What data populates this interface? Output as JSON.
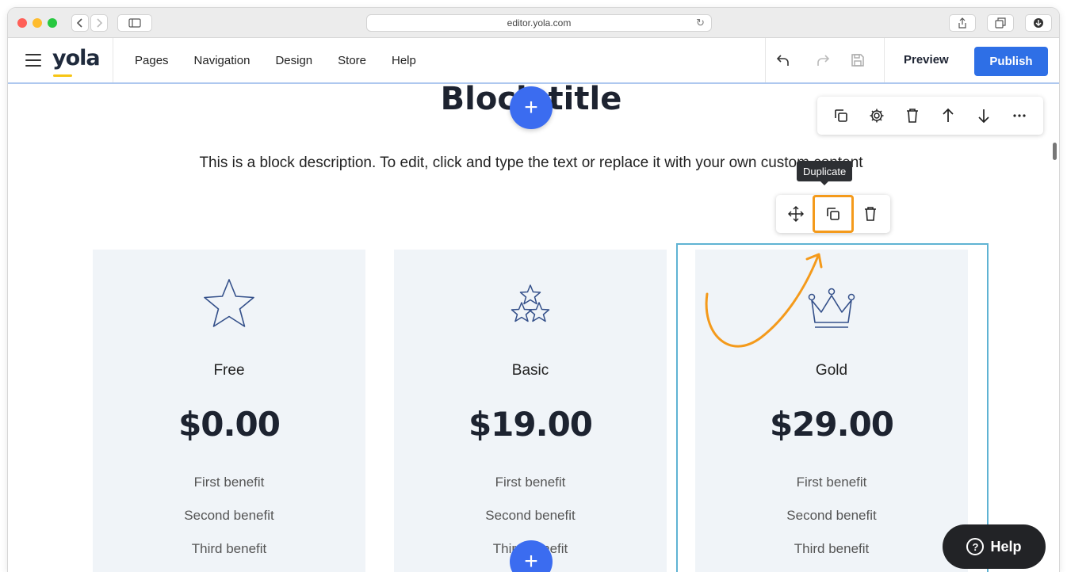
{
  "browser": {
    "url": "editor.yola.com"
  },
  "app": {
    "logo": "yola",
    "nav": [
      "Pages",
      "Navigation",
      "Design",
      "Store",
      "Help"
    ],
    "preview_label": "Preview",
    "publish_label": "Publish"
  },
  "block": {
    "title": "Block title",
    "description": "This is a block description. To edit, click and type the text or replace it with your own custom content",
    "add_label": "+",
    "toolbar_icons": [
      "duplicate-icon",
      "gear-icon",
      "trash-icon",
      "arrow-up-icon",
      "arrow-down-icon",
      "more-icon"
    ]
  },
  "tooltip": {
    "text": "Duplicate"
  },
  "item_toolbar": {
    "icons": [
      "move-icon",
      "duplicate-icon",
      "trash-icon"
    ]
  },
  "cards": [
    {
      "name": "Free",
      "price": "$0.00",
      "icon": "star-icon",
      "benefits": [
        "First benefit",
        "Second benefit",
        "Third benefit"
      ]
    },
    {
      "name": "Basic",
      "price": "$19.00",
      "icon": "three-stars-icon",
      "benefits": [
        "First benefit",
        "Second benefit",
        "Third benefit"
      ]
    },
    {
      "name": "Gold",
      "price": "$29.00",
      "icon": "crown-icon",
      "benefits": [
        "First benefit",
        "Second benefit",
        "Third benefit"
      ]
    }
  ],
  "help_button": {
    "label": "Help"
  },
  "colors": {
    "publish": "#2e6fe6",
    "add_button": "#3b6cf0",
    "highlight": "#f49a1b",
    "selected_frame": "#5fb3d3",
    "card_bg": "#f0f4f8"
  }
}
